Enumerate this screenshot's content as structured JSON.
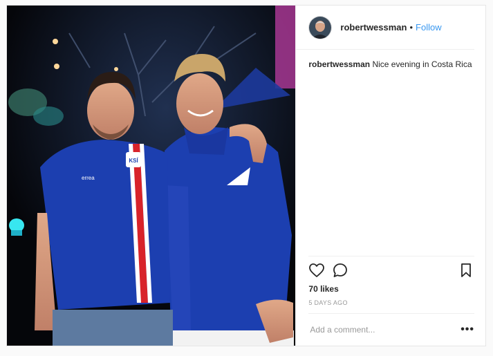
{
  "post": {
    "username": "robertwessman",
    "follow_label": "Follow",
    "separator": "•",
    "caption_user": "robertwessman",
    "caption_text": "Nice evening in Costa Rica",
    "likes": "70 likes",
    "time_ago": "5 DAYS AGO",
    "comment_placeholder": "Add a comment...",
    "more_label": "•••"
  },
  "photo": {
    "jersey_crest_text": "KSÍ",
    "brand_text": "errea"
  },
  "icons": {
    "like": "heart-icon",
    "comment": "comment-icon",
    "save": "bookmark-icon",
    "more": "more-options-icon"
  },
  "colors": {
    "accent": "#3897f0",
    "jersey_blue": "#1c3fb0",
    "stripe_red": "#d8232a"
  }
}
